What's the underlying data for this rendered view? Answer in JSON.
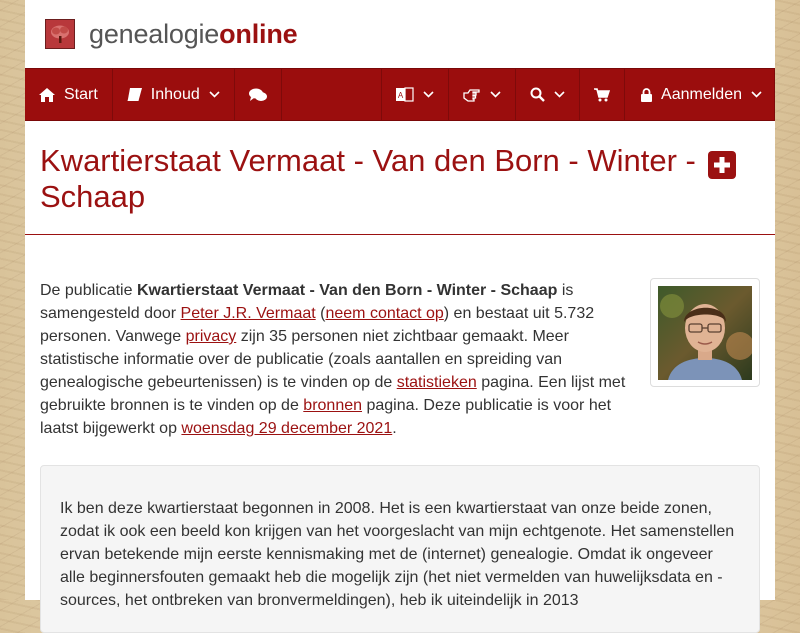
{
  "brand": {
    "part1": "genealogie",
    "part2": "online"
  },
  "nav": {
    "start": "Start",
    "inhoud": "Inhoud",
    "aanmelden": "Aanmelden"
  },
  "title": {
    "line1": "Kwartierstaat Vermaat - Van den Born - Winter -",
    "line2": "Schaap"
  },
  "intro": {
    "t1": "De publicatie ",
    "pubname": "Kwartierstaat Vermaat - Van den Born - Winter - Schaap",
    "t2": " is samengesteld door ",
    "author": "Peter J.R. Vermaat",
    "t3": " (",
    "contact": "neem contact op",
    "t4": ") en bestaat uit 5.732 personen. Vanwege ",
    "privacy": "privacy",
    "t5": " zijn 35 personen niet zichtbaar gemaakt. Meer statistische informatie over de publicatie (zoals aantallen en spreiding van genealogische gebeurtenissen) is te vinden op de ",
    "stats": "statistieken",
    "t6": " pagina. Een lijst met gebruikte bronnen is te vinden op de ",
    "bronnen": "bronnen",
    "t7": " pagina. Deze publicatie is voor het laatst bijgewerkt op ",
    "date": "woensdag 29 december 2021",
    "t8": "."
  },
  "description": "Ik ben deze kwartierstaat begonnen in 2008. Het is een kwartierstaat van onze beide zonen, zodat ik ook een beeld kon krijgen van het voorgeslacht van mijn echtgenote. Het samenstellen ervan betekende mijn eerste kennismaking met de (internet) genealogie. Omdat ik ongeveer alle beginnersfouten gemaakt heb die mogelijk zijn (het niet vermelden van huwelijksdata en - sources, het ontbreken van bronvermeldingen), heb ik uiteindelijk in 2013",
  "colors": {
    "accent": "#9b1111",
    "navbar": "#9b0d0d"
  },
  "icons": [
    "home-icon",
    "book-icon",
    "comments-icon",
    "language-icon",
    "hand-pointer-icon",
    "search-icon",
    "cart-icon",
    "lock-icon",
    "plus-square-icon",
    "tree-logo-icon"
  ]
}
